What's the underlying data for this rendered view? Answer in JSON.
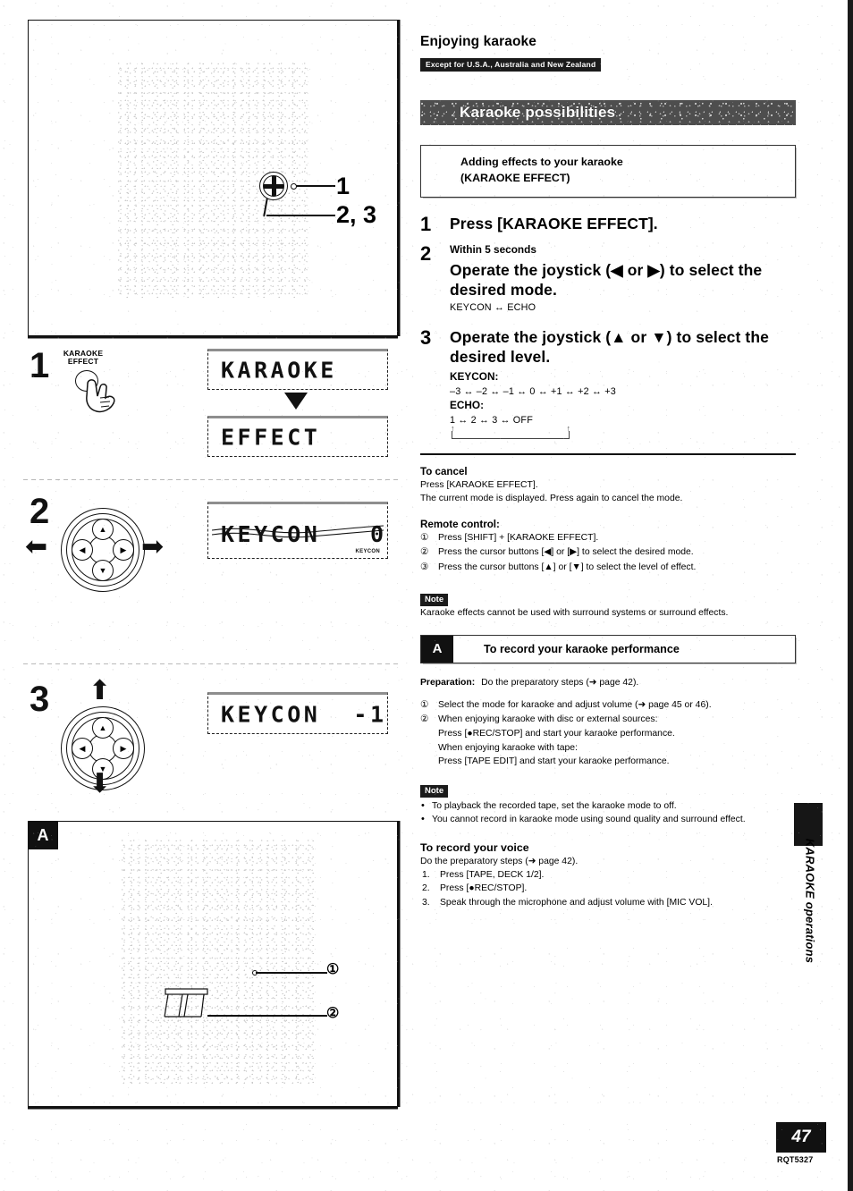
{
  "page": {
    "number": "47",
    "doc_code": "RQT5327",
    "side_tab": "KARAOKE operations"
  },
  "header": {
    "title": "Enjoying karaoke",
    "region_tag": "Except for U.S.A., Australia and New Zealand",
    "banner": "Karaoke possibilities"
  },
  "subbox": {
    "line1": "Adding effects to your karaoke",
    "line2": "(KARAOKE EFFECT)"
  },
  "steps": [
    {
      "num": "1",
      "lead": "Press [KARAOKE EFFECT]."
    },
    {
      "num": "2",
      "pre": "Within 5 seconds",
      "lead": "Operate the joystick (◀ or ▶) to select the desired mode.",
      "detail": "KEYCON ↔ ECHO"
    },
    {
      "num": "3",
      "lead": "Operate the joystick (▲ or ▼) to select the desired level.",
      "sub1_label": "KEYCON:",
      "sub1_values": "–3 ↔ –2 ↔ –1 ↔ 0 ↔ +1 ↔ +2 ↔ +3",
      "sub2_label": "ECHO:",
      "sub2_values": "1 ↔ 2 ↔ 3 ↔ OFF"
    }
  ],
  "cancel": {
    "heading": "To cancel",
    "line1": "Press [KARAOKE EFFECT].",
    "line2": "The current mode is displayed. Press again to cancel the mode."
  },
  "remote": {
    "heading": "Remote control:",
    "items": [
      {
        "marker": "①",
        "text": "Press [SHIFT] + [KARAOKE EFFECT]."
      },
      {
        "marker": "②",
        "text": "Press the cursor buttons [◀] or [▶] to select the desired mode."
      },
      {
        "marker": "③",
        "text": "Press the cursor buttons [▲] or [▼] to select the level of effect."
      }
    ]
  },
  "note_top": {
    "tag": "Note",
    "text": "Karaoke effects cannot be used with surround systems or surround effects."
  },
  "record_section": {
    "badge": "A",
    "title": "To record your karaoke performance",
    "preparation_label": "Preparation:",
    "preparation_text": "Do the preparatory steps (➜ page 42).",
    "items": [
      {
        "marker": "①",
        "text": "Select the mode for karaoke and adjust volume (➜ page 45 or 46)."
      },
      {
        "marker": "②",
        "lines": [
          "When enjoying karaoke with disc or external sources:",
          "Press [●REC/STOP] and start your karaoke performance.",
          "When enjoying karaoke with tape:",
          "Press [TAPE EDIT] and start your karaoke performance."
        ]
      }
    ]
  },
  "note_bottom": {
    "tag": "Note",
    "bullets": [
      "To playback the recorded tape, set the karaoke mode to off.",
      "You cannot record in karaoke mode using sound quality and surround effect."
    ]
  },
  "voice_section": {
    "heading": "To record your voice",
    "intro": "Do the preparatory steps (➜ page 42).",
    "items": [
      {
        "marker": "1.",
        "text": "Press [TAPE, DECK 1/2]."
      },
      {
        "marker": "2.",
        "text": "Press [●REC/STOP]."
      },
      {
        "marker": "3.",
        "text": "Speak through the microphone and adjust volume with [MIC VOL]."
      }
    ]
  },
  "figures": {
    "top_photo": {
      "callout_1": "1",
      "callout_23": "2, 3"
    },
    "step1": {
      "num": "1",
      "button_line1": "KARAOKE",
      "button_line2": "EFFECT",
      "display_1": "KARAOKE",
      "display_2": "EFFECT"
    },
    "step2": {
      "num": "2",
      "display": "KEYCON   0",
      "display_tag": "KEYCON"
    },
    "step3": {
      "num": "3",
      "display": "KEYCON  -1"
    },
    "panel_a": {
      "badge": "A",
      "callout_1": "①",
      "callout_2": "②"
    }
  }
}
